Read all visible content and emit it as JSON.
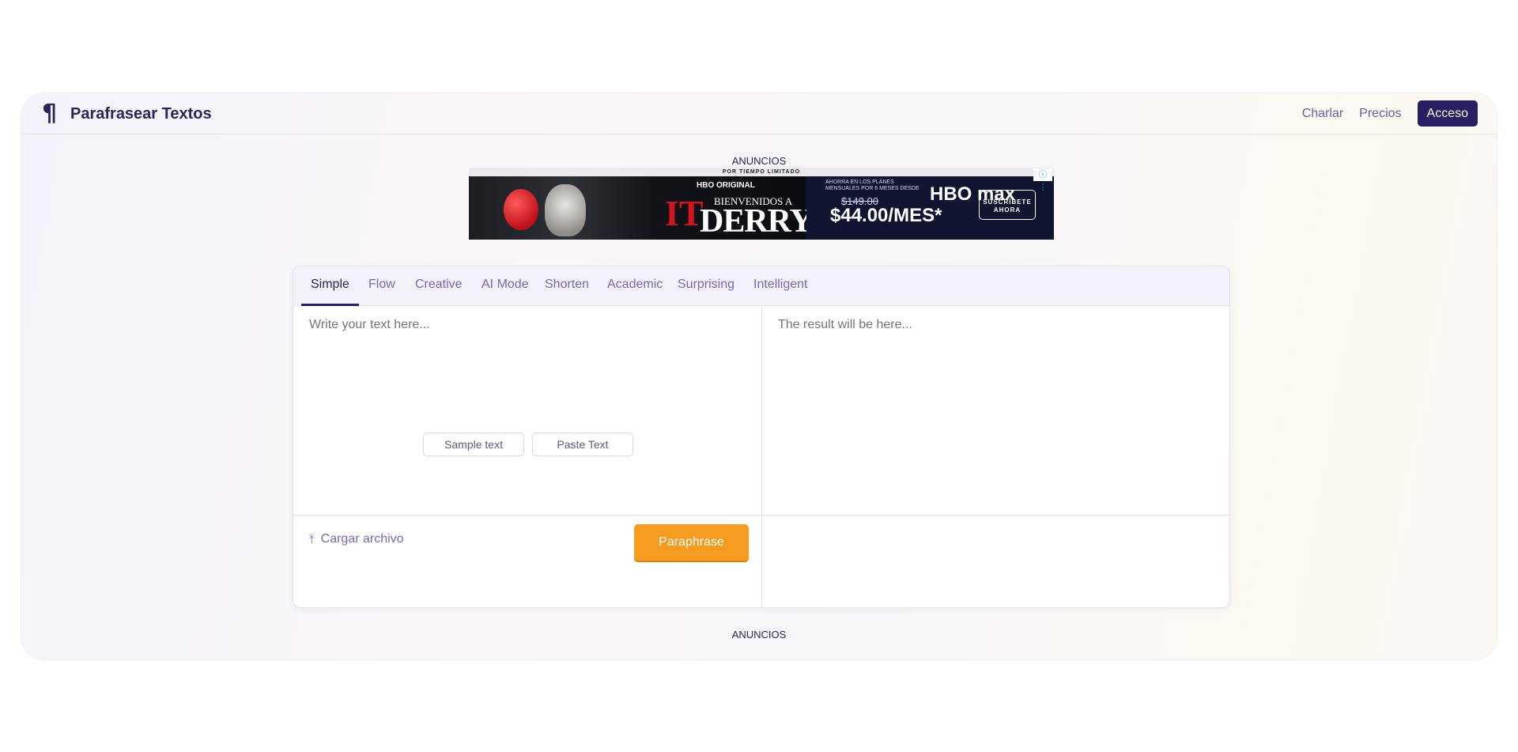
{
  "header": {
    "logo_icon": "pilcrow-icon",
    "logo_glyph": "¶",
    "title": "Parafrasear Textos",
    "nav": {
      "chat": "Charlar",
      "pricing": "Precios",
      "login": "Acceso"
    }
  },
  "ads": {
    "label_top": "ANUNCIOS",
    "label_bottom": "ANUNCIOS",
    "banner": {
      "top_text": "POR TIEMPO LIMITADO",
      "hbo_original": "HBO ORIGINAL",
      "welcome": "BIENVENIDOS A",
      "it": "IT",
      "derry": "DERRY",
      "offer_small": "AHORRA EN LOS PLANES MENSUALES POR 6 MESES DESDE",
      "old_price": "$149.00",
      "new_price": "$44.00/MES*",
      "brand": "HBO max",
      "cta": "SUSCRÍBETE AHORA",
      "choice_glyph": "ⓘ ⋮"
    }
  },
  "editor": {
    "tabs": [
      "Simple",
      "Flow",
      "Creative",
      "AI Mode",
      "Shorten",
      "Academic",
      "Surprising",
      "Intelligent"
    ],
    "active_tab": "Simple",
    "input_placeholder": "Write your text here...",
    "output_placeholder": "The result will be here...",
    "sample_button": "Sample text",
    "paste_button": "Paste Text",
    "upload_icon": "upload-icon",
    "upload_glyph": "⤒",
    "upload_label": "Cargar archivo",
    "paraphrase_button": "Paraphrase"
  },
  "colors": {
    "primary": "#2b1f63",
    "accent": "#f59b1f",
    "tab_text": "#7b67b2"
  }
}
